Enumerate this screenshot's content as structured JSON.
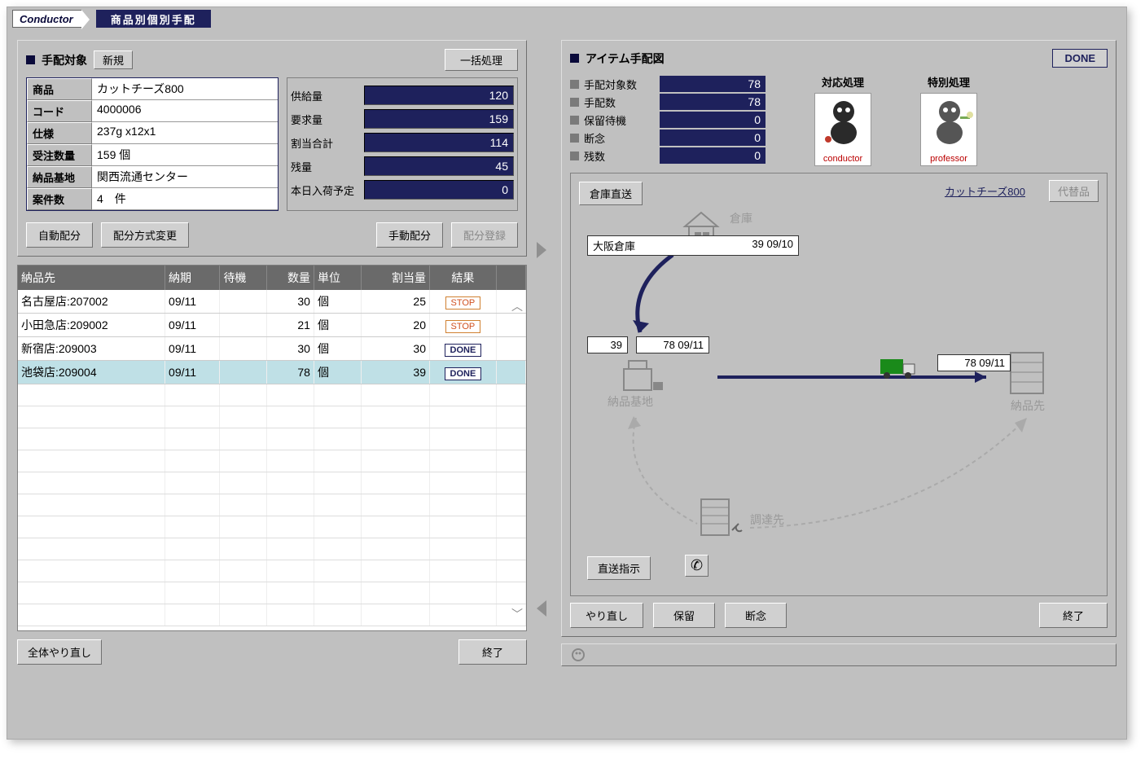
{
  "header": {
    "app_name": "Conductor",
    "page_title": "商品別個別手配"
  },
  "left": {
    "target_title": "手配対象",
    "new_btn": "新規",
    "bulk_btn": "一括処理",
    "product": {
      "labels": {
        "name": "商品",
        "code": "コード",
        "spec": "仕様",
        "order_qty": "受注数量",
        "base": "納品基地",
        "cases": "案件数"
      },
      "values": {
        "name": "カットチーズ800",
        "code": "4000006",
        "spec": "237g x12x1",
        "order_qty": "159 個",
        "base": "関西流通センター",
        "cases": "4　件"
      }
    },
    "metrics": {
      "labels": {
        "supply": "供給量",
        "demand": "要求量",
        "alloc": "割当合計",
        "remain": "残量",
        "today": "本日入荷予定"
      },
      "values": {
        "supply": "120",
        "demand": "159",
        "alloc": "114",
        "remain": "45",
        "today": "0"
      }
    },
    "btns": {
      "auto": "自動配分",
      "method": "配分方式変更",
      "manual": "手動配分",
      "register": "配分登録"
    },
    "table": {
      "headers": {
        "dest": "納品先",
        "due": "納期",
        "wait": "待機",
        "qty": "数量",
        "unit": "単位",
        "alloc": "割当量",
        "result": "結果"
      },
      "rows": [
        {
          "dest": "名古屋店:207002",
          "due": "09/11",
          "wait": "",
          "qty": "30",
          "unit": "個",
          "alloc": "25",
          "result": "STOP",
          "result_type": "stop",
          "sel": false
        },
        {
          "dest": "小田急店:209002",
          "due": "09/11",
          "wait": "",
          "qty": "21",
          "unit": "個",
          "alloc": "20",
          "result": "STOP",
          "result_type": "stop",
          "sel": false
        },
        {
          "dest": "新宿店:209003",
          "due": "09/11",
          "wait": "",
          "qty": "30",
          "unit": "個",
          "alloc": "30",
          "result": "DONE",
          "result_type": "done",
          "sel": false
        },
        {
          "dest": "池袋店:209004",
          "due": "09/11",
          "wait": "",
          "qty": "78",
          "unit": "個",
          "alloc": "39",
          "result": "DONE",
          "result_type": "done",
          "sel": true
        }
      ]
    },
    "footer": {
      "redo_all": "全体やり直し",
      "end": "終了"
    }
  },
  "right": {
    "title": "アイテム手配図",
    "done_btn": "DONE",
    "stats": {
      "labels": {
        "targets": "手配対象数",
        "arranged": "手配数",
        "hold": "保留待機",
        "giveup": "断念",
        "remain": "残数"
      },
      "values": {
        "targets": "78",
        "arranged": "78",
        "hold": "0",
        "giveup": "0",
        "remain": "0"
      }
    },
    "proc": {
      "normal_title": "対応処理",
      "special_title": "特別処理",
      "conductor": "conductor",
      "professor": "professor"
    },
    "diagram": {
      "direct_wh": "倉庫直送",
      "product_link": "カットチーズ800",
      "substitute": "代替品",
      "wh_label": "倉庫",
      "wh_info": {
        "name": "大阪倉庫",
        "qty_date": "39 09/10"
      },
      "base_label": "納品基地",
      "base_qty": "39",
      "base_ship": "78 09/11",
      "dest_label": "納品先",
      "dest_info": "78 09/11",
      "supplier_label": "調達先",
      "direct_ship": "直送指示"
    },
    "footer": {
      "redo": "やり直し",
      "hold": "保留",
      "giveup": "断念",
      "end": "終了"
    }
  }
}
